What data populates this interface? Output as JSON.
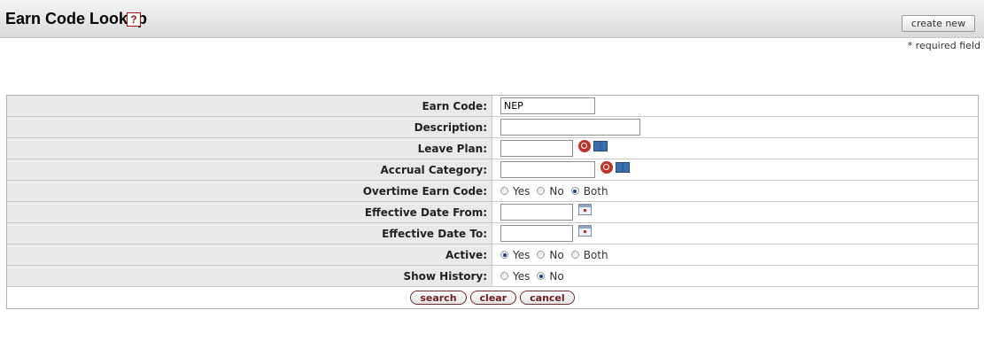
{
  "header": {
    "title": "Earn Code Lookup",
    "help_label": "?",
    "create_new_label": "create new",
    "required_note": "* required field"
  },
  "form": {
    "earn_code": {
      "label": "Earn Code:",
      "value": "NEP"
    },
    "description": {
      "label": "Description:",
      "value": ""
    },
    "leave_plan": {
      "label": "Leave Plan:",
      "value": ""
    },
    "accrual_category": {
      "label": "Accrual Category:",
      "value": ""
    },
    "overtime_earn_code": {
      "label": "Overtime Earn Code:",
      "options": [
        "Yes",
        "No",
        "Both"
      ],
      "selected": "Both"
    },
    "effective_date_from": {
      "label": "Effective Date From:",
      "value": ""
    },
    "effective_date_to": {
      "label": "Effective Date To:",
      "value": ""
    },
    "active": {
      "label": "Active:",
      "options": [
        "Yes",
        "No",
        "Both"
      ],
      "selected": "Yes"
    },
    "show_history": {
      "label": "Show History:",
      "options": [
        "Yes",
        "No"
      ],
      "selected": "No"
    }
  },
  "actions": {
    "search_label": "search",
    "clear_label": "clear",
    "cancel_label": "cancel"
  },
  "icons": {
    "help": "help-icon",
    "lookup": "magnifier-lookup-icon",
    "direct_inquiry": "book-icon",
    "calendar": "calendar-icon"
  },
  "colors": {
    "accent_red": "#c0352b",
    "button_text": "#6d1f1f",
    "label_bg": "#e9e9e9"
  }
}
